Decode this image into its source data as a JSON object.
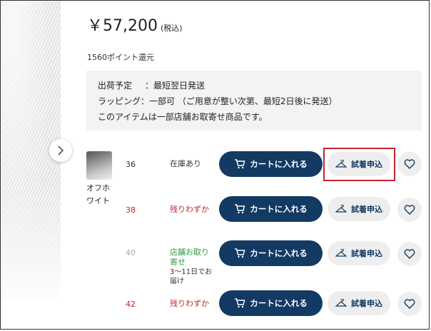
{
  "price": {
    "amount": "￥57,200",
    "tax_label": "(税込)"
  },
  "points": "1560ポイント還元",
  "info": {
    "ship_key": "出荷予定",
    "ship_val": "：最短翌日発送",
    "wrap_key": "ラッピング",
    "wrap_val": "：一部可 （ご用意が整い次第、最短2日後に発送）",
    "note": "このアイテムは一部店舗お取寄せ商品です。"
  },
  "variant": {
    "color_name": "オフホワイト"
  },
  "rows": [
    {
      "size": "36",
      "stock": "在庫あり",
      "stock_sub": "",
      "cart_label": "カートに入れる",
      "try_label": "試着申込"
    },
    {
      "size": "38",
      "stock": "残りわずか",
      "stock_sub": "",
      "cart_label": "カートに入れる",
      "try_label": "試着申込"
    },
    {
      "size": "40",
      "stock": "店舗お取り寄せ",
      "stock_sub": "3〜11日でお届け",
      "cart_label": "カートに入れる",
      "try_label": "試着申込"
    },
    {
      "size": "42",
      "stock": "残りわずか",
      "stock_sub": "",
      "cart_label": "カートに入れる",
      "try_label": "試着申込"
    }
  ],
  "colors": {
    "navy": "#123a63",
    "red": "#c0282d",
    "green": "#2f9a3a"
  },
  "icons": {
    "cart": "cart-icon",
    "hanger": "hanger-icon",
    "heart": "heart-icon",
    "arrow": "chevron-right-icon"
  }
}
